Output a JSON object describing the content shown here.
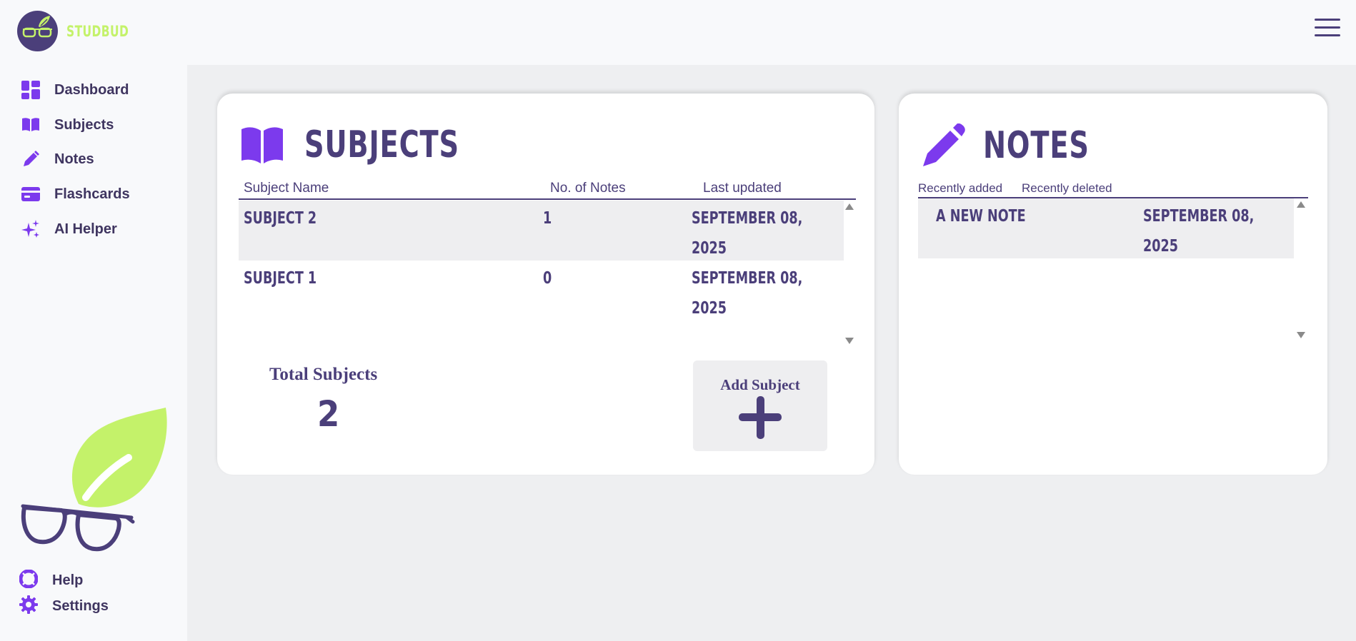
{
  "app": {
    "name": "STUDBUD"
  },
  "sidebar": {
    "items": [
      {
        "label": "Dashboard",
        "icon": "dashboard-icon"
      },
      {
        "label": "Subjects",
        "icon": "book-icon"
      },
      {
        "label": "Notes",
        "icon": "pencil-icon"
      },
      {
        "label": "Flashcards",
        "icon": "card-icon"
      },
      {
        "label": "AI Helper",
        "icon": "sparkle-icon"
      }
    ],
    "footer": [
      {
        "label": "Help",
        "icon": "lifebuoy-icon"
      },
      {
        "label": "Settings",
        "icon": "gear-icon"
      }
    ]
  },
  "subjects": {
    "title": "SUBJECTS",
    "columns": [
      "Subject Name",
      "No. of Notes",
      "Last updated"
    ],
    "rows": [
      {
        "name": "SUBJECT 2",
        "notes": "1",
        "updated_line1": "SEPTEMBER 08,",
        "updated_line2": "2025"
      },
      {
        "name": "SUBJECT 1",
        "notes": "0",
        "updated_line1": "SEPTEMBER 08,",
        "updated_line2": "2025"
      }
    ],
    "total_label": "Total Subjects",
    "total_value": "2",
    "add_label": "Add Subject"
  },
  "notes": {
    "title": "NOTES",
    "tabs": [
      "Recently added",
      "Recently deleted"
    ],
    "rows": [
      {
        "name": "A NEW NOTE",
        "updated_line1": "SEPTEMBER 08,",
        "updated_line2": "2025"
      }
    ]
  },
  "colors": {
    "primary": "#4b3f7a",
    "accent": "#7c3aed",
    "brand_green": "#c4f26a",
    "background": "#eeeff1"
  }
}
